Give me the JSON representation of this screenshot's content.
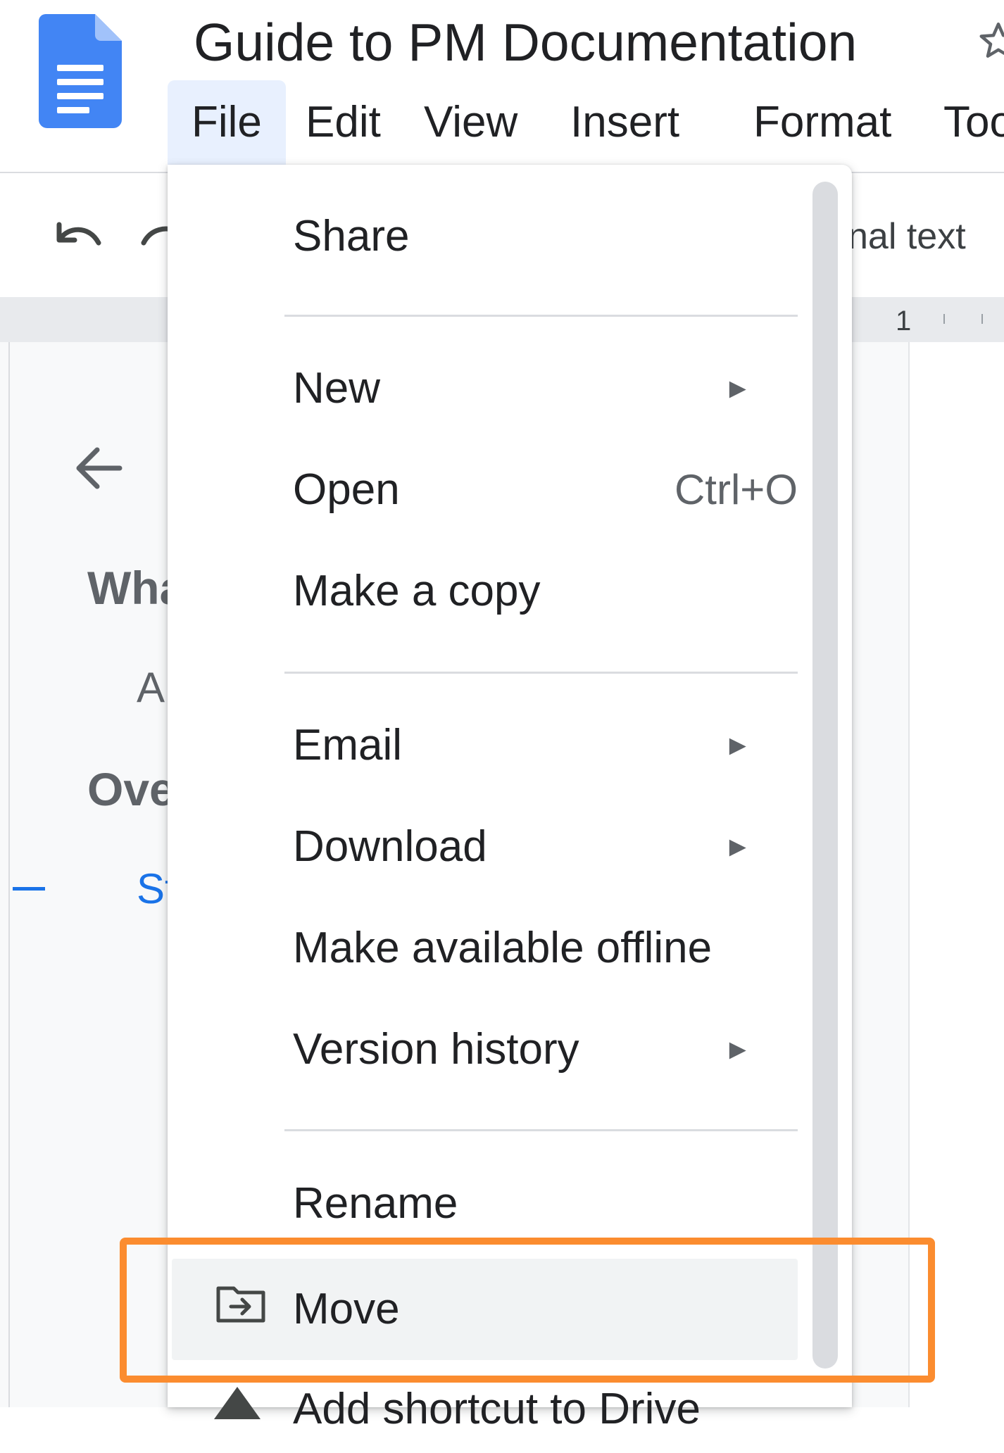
{
  "app": {
    "doc_title": "Guide to PM Documentation",
    "logo_icon": "google-docs-logo",
    "star_icon": "star-outline-icon"
  },
  "menubar": {
    "items": [
      {
        "label": "File",
        "active": true
      },
      {
        "label": "Edit"
      },
      {
        "label": "View"
      },
      {
        "label": "Insert"
      },
      {
        "label": "Format"
      },
      {
        "label": "Tool"
      }
    ]
  },
  "toolbar": {
    "undo_icon": "undo-icon",
    "redo_icon": "redo-icon",
    "partial_text": "nal text"
  },
  "ruler": {
    "number": "1"
  },
  "outline": {
    "back_icon": "arrow-back-icon",
    "heading_1": "Wha",
    "sub_1": "A",
    "heading_2": "Ove",
    "sub_2": "St"
  },
  "file_menu": {
    "items": [
      {
        "label": "Share"
      },
      {
        "label": "New",
        "submenu": true
      },
      {
        "label": "Open",
        "shortcut": "Ctrl+O"
      },
      {
        "label": "Make a copy"
      },
      {
        "label": "Email",
        "submenu": true
      },
      {
        "label": "Download",
        "submenu": true
      },
      {
        "label": "Make available offline"
      },
      {
        "label": "Version history",
        "submenu": true
      },
      {
        "label": "Rename"
      },
      {
        "label": "Move",
        "icon": "folder-move-icon",
        "highlighted": true
      },
      {
        "label": "Add shortcut to Drive",
        "icon": "drive-icon"
      }
    ],
    "arrow_glyph": "►"
  },
  "colors": {
    "accent": "#1a73e8",
    "highlight_box": "#fb8c2f",
    "menu_hover": "#f1f3f4",
    "active_menu_bg": "#e8f0fe"
  }
}
